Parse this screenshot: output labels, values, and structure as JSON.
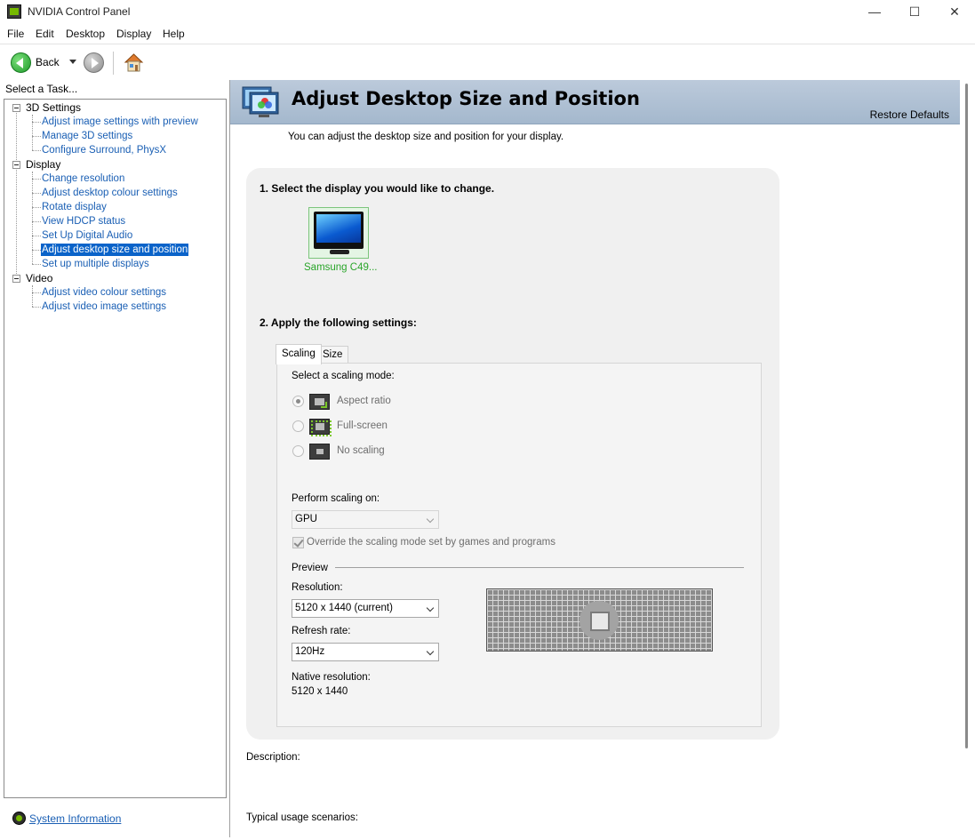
{
  "window": {
    "title": "NVIDIA Control Panel",
    "minimize": "—",
    "maximize": "☐",
    "close": "✕"
  },
  "menu": [
    "File",
    "Edit",
    "Desktop",
    "Display",
    "Help"
  ],
  "toolbar": {
    "back_label": "Back",
    "icons": [
      "back-arrow-icon",
      "forward-arrow-icon",
      "home-icon"
    ]
  },
  "sidebar": {
    "title": "Select a Task...",
    "categories": [
      {
        "label": "3D Settings",
        "items": [
          "Adjust image settings with preview",
          "Manage 3D settings",
          "Configure Surround, PhysX"
        ]
      },
      {
        "label": "Display",
        "items": [
          "Change resolution",
          "Adjust desktop colour settings",
          "Rotate display",
          "View HDCP status",
          "Set Up Digital Audio",
          "Adjust desktop size and position",
          "Set up multiple displays"
        ],
        "selected": "Adjust desktop size and position"
      },
      {
        "label": "Video",
        "items": [
          "Adjust video colour settings",
          "Adjust video image settings"
        ]
      }
    ],
    "system_info": "System Information"
  },
  "page": {
    "title": "Adjust Desktop Size and Position",
    "restore_defaults": "Restore Defaults",
    "intro": "You can adjust the desktop size and position for your display.",
    "step1": "1. Select the display you would like to change.",
    "display_name": "Samsung C49...",
    "step2": "2. Apply the following settings:",
    "tabs": [
      "Scaling",
      "Size"
    ],
    "active_tab": "Scaling",
    "scaling_mode_label": "Select a scaling mode:",
    "scaling_modes": [
      {
        "label": "Aspect ratio",
        "checked": true
      },
      {
        "label": "Full-screen",
        "checked": false
      },
      {
        "label": "No scaling",
        "checked": false
      }
    ],
    "perform_scaling_label": "Perform scaling on:",
    "perform_scaling_value": "GPU",
    "override_label": "Override the scaling mode set by games and programs",
    "override_checked": true,
    "preview_label": "Preview",
    "resolution_label": "Resolution:",
    "resolution_value": "5120 x 1440 (current)",
    "refresh_label": "Refresh rate:",
    "refresh_value": "120Hz",
    "native_label": "Native resolution:",
    "native_value": "5120 x 1440",
    "description_label": "Description:",
    "usage_label": "Typical usage scenarios:"
  },
  "colors": {
    "header_band": "#a4b8cd",
    "link": "#1a5fb4",
    "selected": "#0a63c9",
    "nvidia_green": "#76b900",
    "display_name": "#2aa52a"
  }
}
